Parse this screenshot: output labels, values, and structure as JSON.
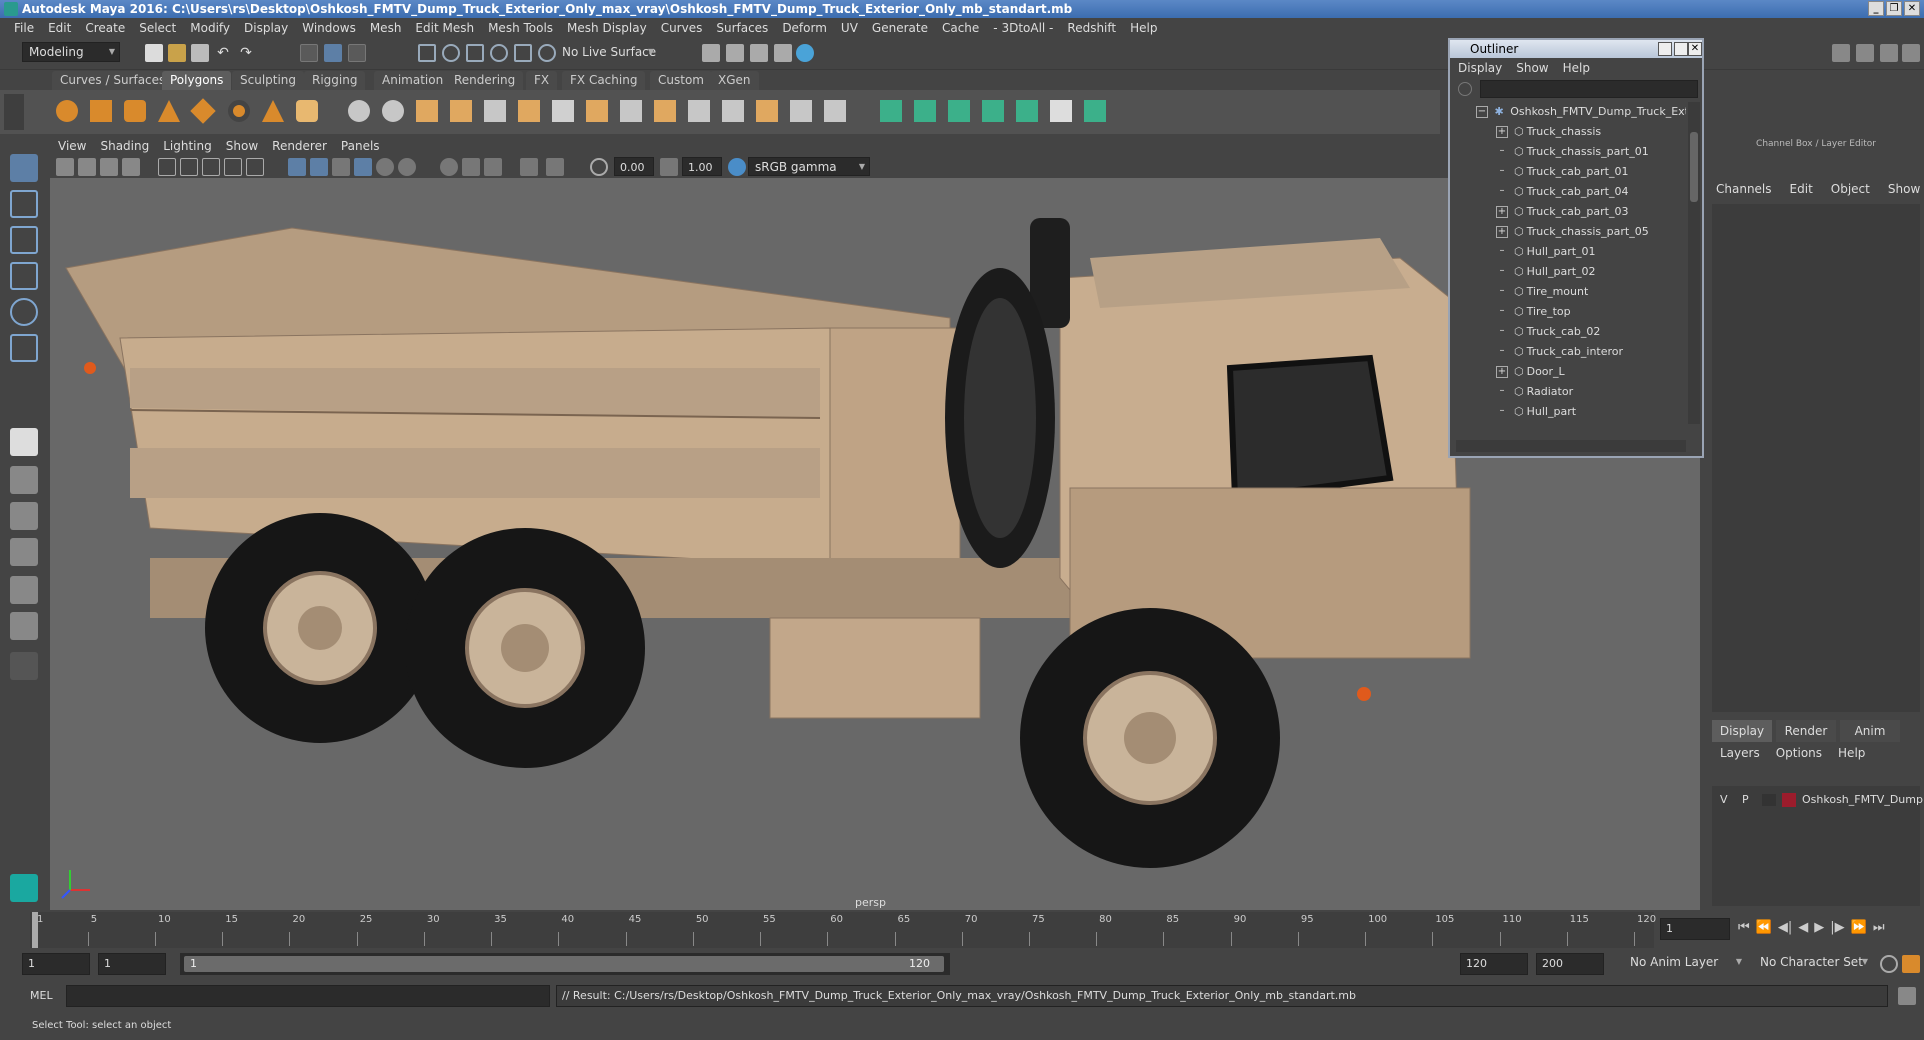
{
  "app": {
    "title": "Autodesk Maya 2016: C:\\Users\\rs\\Desktop\\Oshkosh_FMTV_Dump_Truck_Exterior_Only_max_vray\\Oshkosh_FMTV_Dump_Truck_Exterior_Only_mb_standart.mb"
  },
  "menubar": [
    "File",
    "Edit",
    "Create",
    "Select",
    "Modify",
    "Display",
    "Windows",
    "Mesh",
    "Edit Mesh",
    "Mesh Tools",
    "Mesh Display",
    "Curves",
    "Surfaces",
    "Deform",
    "UV",
    "Generate",
    "Cache",
    "- 3DtoAll -",
    "Redshift",
    "Help"
  ],
  "statusline": {
    "mode": "Modeling",
    "live_surface": "No Live Surface"
  },
  "shelf_tabs": [
    "Curves / Surfaces",
    "Polygons",
    "Sculpting",
    "Rigging",
    "Animation",
    "Rendering",
    "FX",
    "FX Caching",
    "Custom",
    "XGen"
  ],
  "shelf_active": "Polygons",
  "viewport": {
    "menu": [
      "View",
      "Shading",
      "Lighting",
      "Show",
      "Renderer",
      "Panels"
    ],
    "exposure": "0.00",
    "gamma": "1.00",
    "color_space": "sRGB gamma",
    "camera_label": "persp"
  },
  "outliner": {
    "title": "Outliner",
    "menu": [
      "Display",
      "Show",
      "Help"
    ],
    "root": "Oshkosh_FMTV_Dump_Truck_Exte",
    "items": [
      {
        "label": "Truck_chassis",
        "expandable": true
      },
      {
        "label": "Truck_chassis_part_01",
        "expandable": false
      },
      {
        "label": "Truck_cab_part_01",
        "expandable": false
      },
      {
        "label": "Truck_cab_part_04",
        "expandable": false
      },
      {
        "label": "Truck_cab_part_03",
        "expandable": true
      },
      {
        "label": "Truck_chassis_part_05",
        "expandable": true
      },
      {
        "label": "Hull_part_01",
        "expandable": false
      },
      {
        "label": "Hull_part_02",
        "expandable": false
      },
      {
        "label": "Tire_mount",
        "expandable": false
      },
      {
        "label": "Tire_top",
        "expandable": false
      },
      {
        "label": "Truck_cab_02",
        "expandable": false
      },
      {
        "label": "Truck_cab_interor",
        "expandable": false
      },
      {
        "label": "Door_L",
        "expandable": true
      },
      {
        "label": "Radiator",
        "expandable": false
      },
      {
        "label": "Hull_part",
        "expandable": false
      }
    ]
  },
  "channelbox": {
    "header": "Channel Box / Layer Editor",
    "menu": [
      "Channels",
      "Edit",
      "Object",
      "Show"
    ],
    "layer_tabs": [
      "Display",
      "Render",
      "Anim"
    ],
    "layer_menu": [
      "Layers",
      "Options",
      "Help"
    ],
    "layer": {
      "v": "V",
      "p": "P",
      "name": "Oshkosh_FMTV_Dump",
      "color": "#9b1c2c"
    }
  },
  "timeline": {
    "ticks": [
      "1",
      "5",
      "10",
      "15",
      "20",
      "25",
      "30",
      "35",
      "40",
      "45",
      "50",
      "55",
      "60",
      "65",
      "70",
      "75",
      "80",
      "85",
      "90",
      "95",
      "100",
      "105",
      "110",
      "115",
      "120"
    ],
    "current_frame": "1"
  },
  "range": {
    "start": "1",
    "start2": "1",
    "slider_start": "1",
    "slider_end": "120",
    "end": "120",
    "end2": "200",
    "anim_layer": "No Anim Layer",
    "char_set": "No Character Set"
  },
  "cmdline": {
    "lang": "MEL",
    "result": "// Result: C:/Users/rs/Desktop/Oshkosh_FMTV_Dump_Truck_Exterior_Only_max_vray/Oshkosh_FMTV_Dump_Truck_Exterior_Only_mb_standart.mb"
  },
  "helpline": "Select Tool: select an object"
}
